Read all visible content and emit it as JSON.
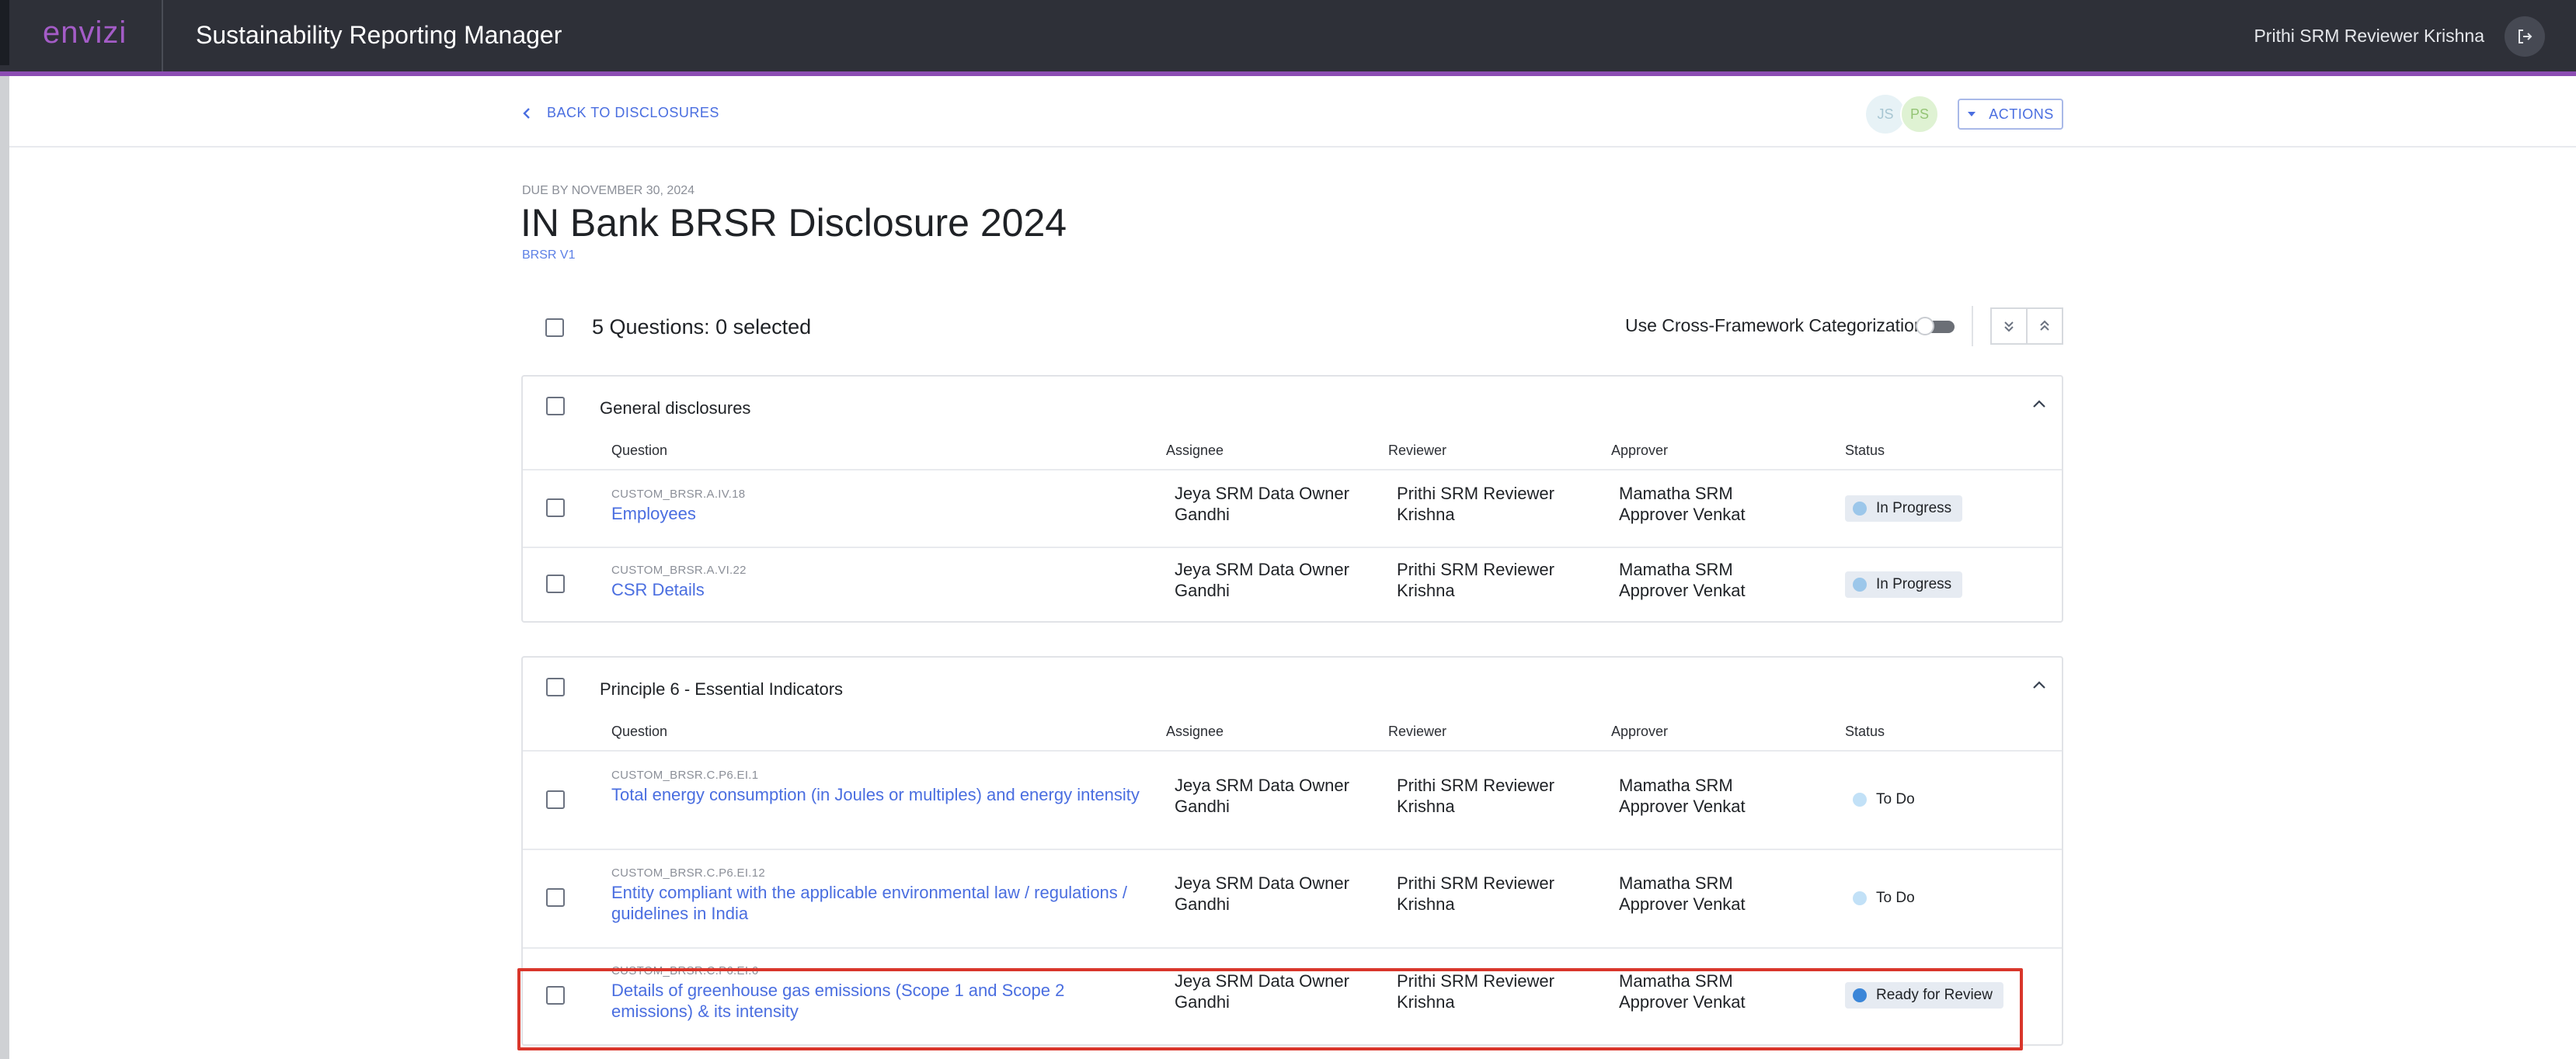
{
  "header": {
    "logo": "envizi",
    "app_title": "Sustainability Reporting Manager",
    "user_name": "Prithi SRM Reviewer Krishna",
    "logout_icon": "logout-icon"
  },
  "topbar": {
    "back_label": "BACK TO DISCLOSURES",
    "avatars": [
      "JS",
      "PS"
    ],
    "actions_label": "ACTIONS"
  },
  "disclosure": {
    "due": "DUE BY NOVEMBER 30, 2024",
    "title": "IN Bank BRSR Disclosure 2024",
    "version": "BRSR V1"
  },
  "toolbar": {
    "question_count": "5 Questions: 0 selected",
    "cross_framework_label": "Use Cross-Framework Categorization",
    "cross_framework_on": false
  },
  "columns": {
    "question": "Question",
    "assignee": "Assignee",
    "reviewer": "Reviewer",
    "approver": "Approver",
    "status": "Status"
  },
  "sections": [
    {
      "title": "General disclosures",
      "rows": [
        {
          "code": "CUSTOM_BRSR.A.IV.18",
          "question": "Employees",
          "assignee": "Jeya SRM Data Owner Gandhi",
          "reviewer": "Prithi SRM Reviewer Krishna",
          "approver": "Mamatha SRM Approver Venkat",
          "status": "In Progress"
        },
        {
          "code": "CUSTOM_BRSR.A.VI.22",
          "question": "CSR Details",
          "assignee": "Jeya SRM Data Owner Gandhi",
          "reviewer": "Prithi SRM Reviewer Krishna",
          "approver": "Mamatha SRM Approver Venkat",
          "status": "In Progress"
        }
      ]
    },
    {
      "title": "Principle 6 - Essential Indicators",
      "rows": [
        {
          "code": "CUSTOM_BRSR.C.P6.EI.1",
          "question": "Total energy consumption (in Joules or multiples) and energy intensity",
          "assignee": "Jeya SRM Data Owner Gandhi",
          "reviewer": "Prithi SRM Reviewer Krishna",
          "approver": "Mamatha SRM Approver Venkat",
          "status": "To Do"
        },
        {
          "code": "CUSTOM_BRSR.C.P6.EI.12",
          "question": "Entity compliant with the applicable environmental law / regulations / guidelines in India",
          "assignee": "Jeya SRM Data Owner Gandhi",
          "reviewer": "Prithi SRM Reviewer Krishna",
          "approver": "Mamatha SRM Approver Venkat",
          "status": "To Do"
        },
        {
          "code": "CUSTOM_BRSR.C.P6.EI.6",
          "question": "Details of greenhouse gas emissions (Scope 1 and Scope 2 emissions) & its intensity",
          "assignee": "Jeya SRM Data Owner Gandhi",
          "reviewer": "Prithi SRM Reviewer Krishna",
          "approver": "Mamatha SRM Approver Venkat",
          "status": "Ready for Review"
        }
      ]
    }
  ],
  "colors": {
    "header_bg": "#2e3038",
    "brand_accent": "#8c4db3",
    "link": "#4a6ee0",
    "highlight": "#d9362b"
  }
}
